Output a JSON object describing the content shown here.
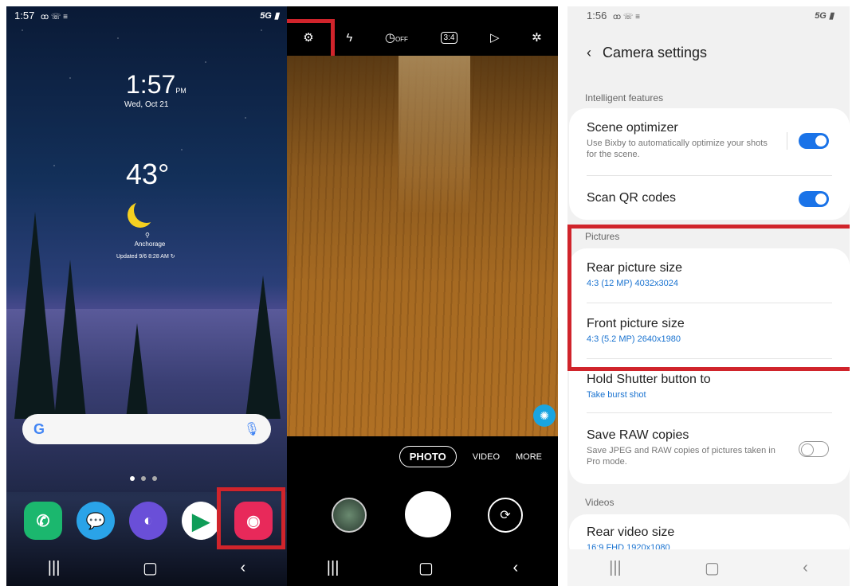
{
  "home": {
    "status_time": "1:57",
    "status_icons_left": "ꝏ ☏ ≡",
    "network": "5G",
    "clock_time": "1:57",
    "clock_ampm": "PM",
    "date": "Wed, Oct 21",
    "temperature": "43°",
    "location": "Anchorage",
    "updated": "Updated 9/6 8:28 AM",
    "dock_apps": [
      "phone-app",
      "messages-app",
      "internet-app",
      "play-store-app",
      "camera-app"
    ]
  },
  "camera": {
    "modes": [
      "PHOTO",
      "VIDEO",
      "MORE"
    ],
    "ratio": "3:4",
    "timer": "OFF"
  },
  "settings": {
    "status_time": "1:56",
    "status_icons_left": "ꝏ ☏ ≡",
    "network": "5G",
    "title": "Camera settings",
    "sections": {
      "intelligent": "Intelligent features",
      "pictures": "Pictures",
      "videos": "Videos"
    },
    "scene_optimizer": {
      "title": "Scene optimizer",
      "subtitle": "Use Bixby to automatically optimize your shots for the scene.",
      "on": true
    },
    "scan_qr": {
      "title": "Scan QR codes",
      "on": true
    },
    "rear_picture": {
      "title": "Rear picture size",
      "value": "4:3 (12 MP) 4032x3024"
    },
    "front_picture": {
      "title": "Front picture size",
      "value": "4:3 (5.2 MP) 2640x1980"
    },
    "hold_shutter": {
      "title": "Hold Shutter button to",
      "value": "Take burst shot"
    },
    "save_raw": {
      "title": "Save RAW copies",
      "subtitle": "Save JPEG and RAW copies of pictures taken in Pro mode.",
      "on": false
    },
    "rear_video": {
      "title": "Rear video size",
      "value": "16:9 FHD 1920x1080"
    }
  },
  "colors": {
    "highlight": "#d0242b",
    "toggle_on": "#1a73e8",
    "link_blue": "#1a73d0"
  }
}
